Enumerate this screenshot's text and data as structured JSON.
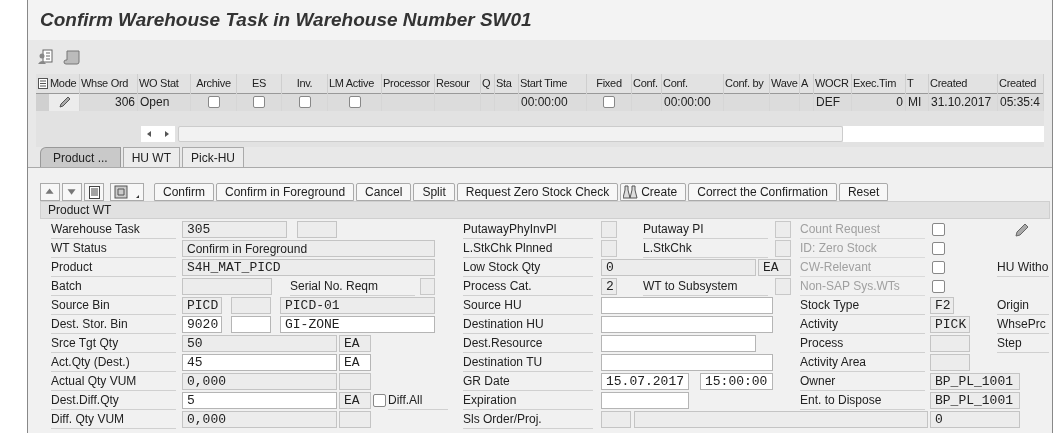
{
  "title": "Confirm Warehouse Task in Warehouse Number SW01",
  "orders_table": {
    "columns": [
      "Mode",
      "Whse Ord",
      "WO Stat",
      "Archive",
      "ES",
      "Inv.",
      "LM Active",
      "Processor",
      "Resour",
      "Q",
      "Sta",
      "Start Time",
      "Fixed",
      "Conf.",
      "Conf.",
      "Conf. by",
      "Wave",
      "A",
      "WOCR",
      "Exec.Tim",
      "T",
      "Created",
      "Created"
    ],
    "rows": [
      {
        "cells": [
          {
            "kind": "mode"
          },
          {
            "kind": "text",
            "text": "306"
          },
          {
            "kind": "text",
            "text": "Open"
          },
          {
            "kind": "checkbox",
            "checked": false
          },
          {
            "kind": "checkbox",
            "checked": false
          },
          {
            "kind": "checkbox",
            "checked": false
          },
          {
            "kind": "checkbox",
            "checked": false
          },
          {
            "kind": "empty"
          },
          {
            "kind": "empty"
          },
          {
            "kind": "empty"
          },
          {
            "kind": "empty"
          },
          {
            "kind": "text",
            "text": "00:00:00"
          },
          {
            "kind": "checkbox",
            "checked": false
          },
          {
            "kind": "empty"
          },
          {
            "kind": "text",
            "text": "00:00:00"
          },
          {
            "kind": "empty"
          },
          {
            "kind": "empty"
          },
          {
            "kind": "empty"
          },
          {
            "kind": "text",
            "text": "DEF"
          },
          {
            "kind": "text",
            "text": "0"
          },
          {
            "kind": "text",
            "text": "MI"
          },
          {
            "kind": "text",
            "text": "31.10.2017"
          },
          {
            "kind": "text",
            "text": "05:35:4"
          }
        ]
      }
    ]
  },
  "tabs": [
    {
      "label": "Product ...",
      "selected": true
    },
    {
      "label": "HU WT",
      "selected": false
    },
    {
      "label": "Pick-HU",
      "selected": false
    }
  ],
  "action_buttons": [
    {
      "label": "Confirm",
      "kind": "text"
    },
    {
      "label": "Confirm in Foreground",
      "kind": "text"
    },
    {
      "label": "Cancel",
      "kind": "text"
    },
    {
      "label": "Split",
      "kind": "text"
    },
    {
      "label": "Request Zero Stock Check",
      "kind": "text"
    },
    {
      "label": "Create",
      "kind": "icon-text"
    },
    {
      "label": "Correct the Confirmation",
      "kind": "text"
    },
    {
      "label": "Reset",
      "kind": "text"
    }
  ],
  "section_title": "Product WT",
  "form_rows": [
    {
      "cells": [
        {
          "kind": "label",
          "text": "Warehouse Task",
          "disabled": false
        },
        {
          "kind": "field",
          "value": "305",
          "editable": false
        },
        {
          "kind": "field",
          "editable": false
        },
        {
          "kind": "label",
          "text": "PutawayPhyInvPl",
          "disabled": false
        },
        {
          "kind": "indicator",
          "checked": false
        },
        {
          "kind": "label",
          "text": "Putaway PI",
          "disabled": false
        },
        {
          "kind": "indicator",
          "checked": false
        },
        {
          "kind": "label",
          "text": "Count Request",
          "disabled": true
        },
        {
          "kind": "checkbox",
          "checked": false
        },
        {
          "kind": "edit-icon"
        }
      ]
    },
    {
      "cells": [
        {
          "kind": "label",
          "text": "WT Status",
          "disabled": false
        },
        {
          "kind": "text-field",
          "value": "Confirm in Foreground",
          "editable": false
        },
        {
          "kind": "label",
          "text": "L.StkChk Plnned",
          "disabled": false
        },
        {
          "kind": "indicator",
          "checked": false
        },
        {
          "kind": "label",
          "text": "L.StkChk",
          "disabled": false
        },
        {
          "kind": "indicator",
          "checked": false
        },
        {
          "kind": "label",
          "text": "ID: Zero Stock",
          "disabled": true
        },
        {
          "kind": "checkbox",
          "checked": false
        }
      ]
    },
    {
      "cells": [
        {
          "kind": "label",
          "text": "Product",
          "disabled": false
        },
        {
          "kind": "field",
          "value": "S4H_MAT_PICD",
          "editable": false
        },
        {
          "kind": "label",
          "text": "Low Stock Qty",
          "disabled": false
        },
        {
          "kind": "field",
          "value": "0",
          "editable": false
        },
        {
          "kind": "field",
          "value": "EA",
          "editable": false
        },
        {
          "kind": "label",
          "text": "CW-Relevant",
          "disabled": true
        },
        {
          "kind": "checkbox",
          "checked": false
        },
        {
          "kind": "label",
          "text": "HU Witho",
          "disabled": false
        }
      ]
    },
    {
      "cells": [
        {
          "kind": "label",
          "text": "Batch",
          "disabled": false
        },
        {
          "kind": "field",
          "editable": false
        },
        {
          "kind": "label",
          "text": "Serial No. Reqm",
          "disabled": false
        },
        {
          "kind": "indicator",
          "checked": false
        },
        {
          "kind": "label",
          "text": "Process Cat.",
          "disabled": false
        },
        {
          "kind": "field",
          "value": "2",
          "editable": false
        },
        {
          "kind": "label",
          "text": "WT to Subsystem",
          "disabled": false
        },
        {
          "kind": "indicator",
          "checked": false
        },
        {
          "kind": "label",
          "text": "Non-SAP Sys.WTs",
          "disabled": true
        },
        {
          "kind": "checkbox",
          "checked": false
        }
      ]
    },
    {
      "cells": [
        {
          "kind": "label",
          "text": "Source Bin",
          "disabled": false
        },
        {
          "kind": "field",
          "value": "PICD",
          "editable": false
        },
        {
          "kind": "field",
          "editable": false
        },
        {
          "kind": "field",
          "value": "PICD-01",
          "editable": false
        },
        {
          "kind": "label",
          "text": "Source HU",
          "disabled": false
        },
        {
          "kind": "field",
          "editable": true
        },
        {
          "kind": "label",
          "text": "Stock Type",
          "disabled": false
        },
        {
          "kind": "field",
          "value": "F2",
          "editable": false
        },
        {
          "kind": "label",
          "text": "Origin",
          "disabled": false
        }
      ]
    },
    {
      "cells": [
        {
          "kind": "label",
          "text": "Dest. Stor. Bin",
          "disabled": false
        },
        {
          "kind": "field",
          "value": "9020",
          "editable": true
        },
        {
          "kind": "field",
          "editable": true
        },
        {
          "kind": "field",
          "value": "GI-ZONE",
          "editable": true
        },
        {
          "kind": "label",
          "text": "Destination HU",
          "disabled": false
        },
        {
          "kind": "field",
          "editable": true
        },
        {
          "kind": "label",
          "text": "Activity",
          "disabled": false
        },
        {
          "kind": "field",
          "value": "PICK",
          "editable": false
        },
        {
          "kind": "label",
          "text": "WhsePrc",
          "disabled": false
        }
      ]
    },
    {
      "cells": [
        {
          "kind": "label",
          "text": "Srce Tgt Qty",
          "disabled": false
        },
        {
          "kind": "field",
          "value": "50",
          "editable": false
        },
        {
          "kind": "field",
          "value": "EA",
          "editable": false
        },
        {
          "kind": "label",
          "text": "Dest.Resource",
          "disabled": false
        },
        {
          "kind": "field",
          "editable": true
        },
        {
          "kind": "label",
          "text": "Process",
          "disabled": false
        },
        {
          "kind": "field",
          "editable": false
        },
        {
          "kind": "label",
          "text": "Step",
          "disabled": false
        }
      ]
    },
    {
      "cells": [
        {
          "kind": "label",
          "text": "Act.Qty (Dest.)",
          "disabled": false
        },
        {
          "kind": "field",
          "value": "45",
          "editable": true
        },
        {
          "kind": "field",
          "value": "EA",
          "editable": true
        },
        {
          "kind": "label",
          "text": "Destination TU",
          "disabled": false
        },
        {
          "kind": "field",
          "editable": true
        },
        {
          "kind": "label",
          "text": "Activity Area",
          "disabled": false
        },
        {
          "kind": "field",
          "editable": false
        }
      ]
    },
    {
      "cells": [
        {
          "kind": "label",
          "text": "Actual Qty VUM",
          "disabled": false
        },
        {
          "kind": "field",
          "value": "0,000",
          "editable": false
        },
        {
          "kind": "field",
          "editable": false
        },
        {
          "kind": "label",
          "text": "GR Date",
          "disabled": false
        },
        {
          "kind": "field",
          "value": "15.07.2017",
          "editable": true
        },
        {
          "kind": "field",
          "value": "15:00:00",
          "editable": true
        },
        {
          "kind": "label",
          "text": "Owner",
          "disabled": false
        },
        {
          "kind": "field",
          "value": "BP_PL_1001",
          "editable": false
        }
      ]
    },
    {
      "cells": [
        {
          "kind": "label",
          "text": "Dest.Diff.Qty",
          "disabled": false
        },
        {
          "kind": "field",
          "value": "5",
          "editable": true
        },
        {
          "kind": "field",
          "value": "EA",
          "editable": false
        },
        {
          "kind": "checkbox",
          "checked": false
        },
        {
          "kind": "label",
          "text": "Diff.All",
          "disabled": false
        },
        {
          "kind": "label",
          "text": "Expiration",
          "disabled": false
        },
        {
          "kind": "field",
          "editable": true
        },
        {
          "kind": "label",
          "text": "Ent. to Dispose",
          "disabled": false
        },
        {
          "kind": "field",
          "value": "BP_PL_1001",
          "editable": false
        }
      ]
    },
    {
      "cells": [
        {
          "kind": "label",
          "text": "Diff. Qty VUM",
          "disabled": false
        },
        {
          "kind": "field",
          "value": "0,000",
          "editable": false
        },
        {
          "kind": "field",
          "editable": false
        },
        {
          "kind": "label",
          "text": "Sls Order/Proj.",
          "disabled": false
        },
        {
          "kind": "field",
          "editable": false
        },
        {
          "kind": "field",
          "editable": false
        },
        {
          "kind": "field",
          "value": "0",
          "editable": false
        }
      ]
    }
  ]
}
